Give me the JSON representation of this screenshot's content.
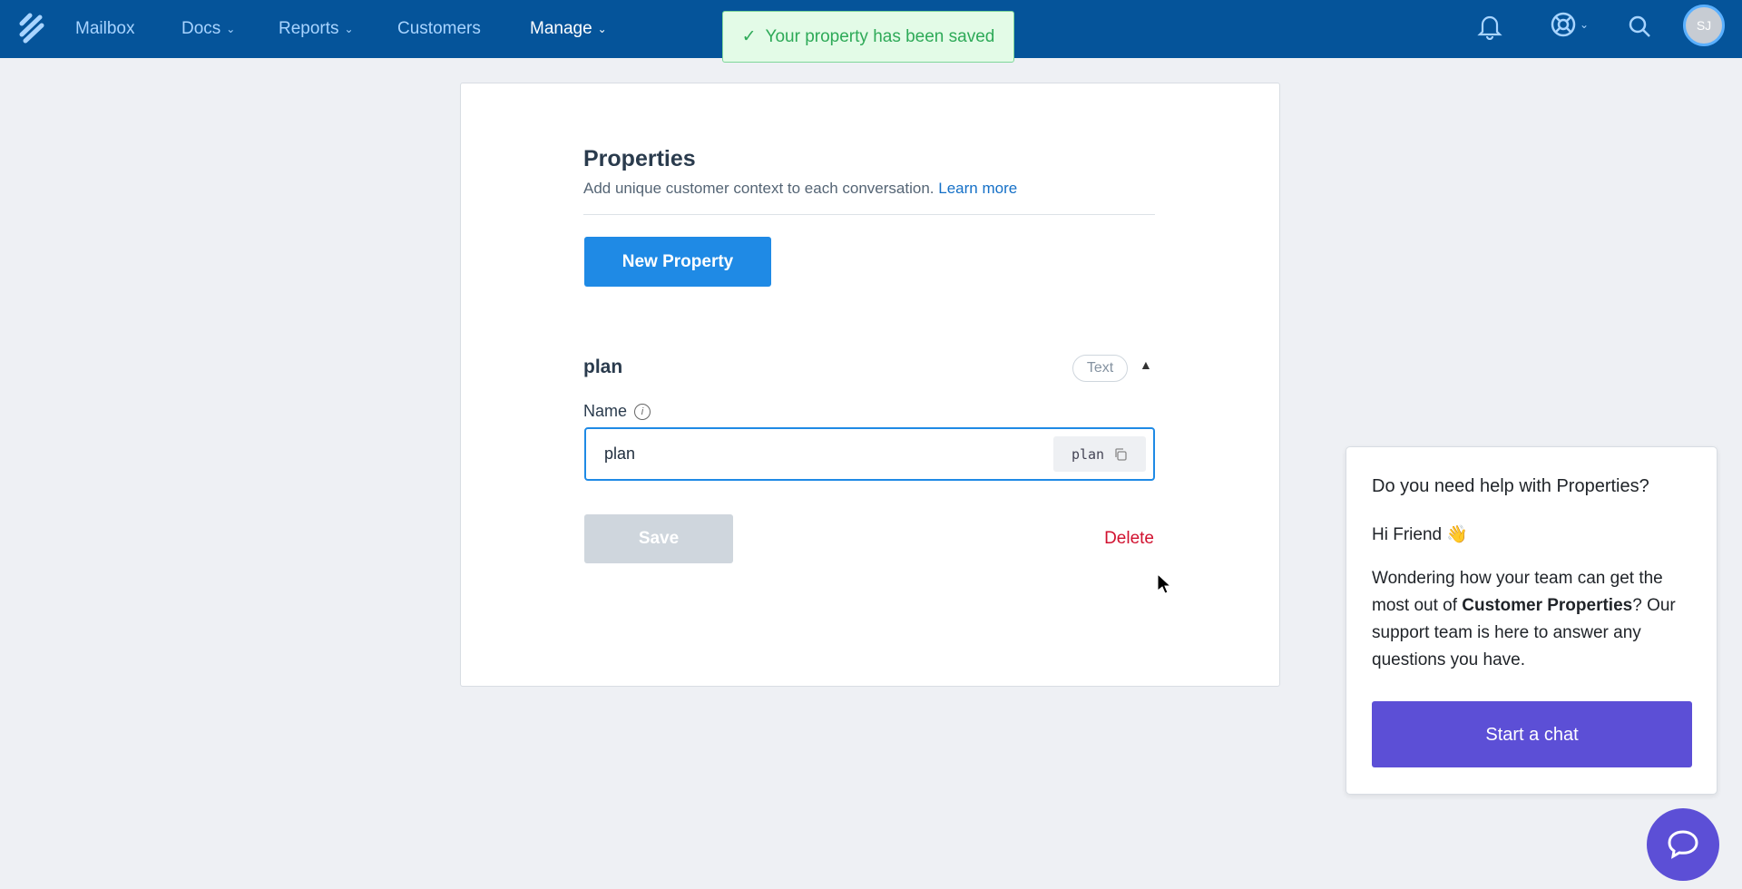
{
  "nav": {
    "items": [
      {
        "label": "Mailbox",
        "dropdown": false
      },
      {
        "label": "Docs",
        "dropdown": true
      },
      {
        "label": "Reports",
        "dropdown": true
      },
      {
        "label": "Customers",
        "dropdown": false
      },
      {
        "label": "Manage",
        "dropdown": true,
        "active": true
      }
    ],
    "avatar_initials": "SJ",
    "icons": [
      "bell-icon",
      "lifebuoy-icon",
      "search-icon"
    ]
  },
  "toast": {
    "message": "Your property has been saved"
  },
  "page": {
    "title": "Properties",
    "subtitle": "Add unique customer context to each conversation.",
    "learn_more": "Learn more",
    "new_button": "New Property"
  },
  "property": {
    "name": "plan",
    "type_badge": "Text",
    "field_label": "Name",
    "field_value": "plan",
    "slug": "plan",
    "save_label": "Save",
    "delete_label": "Delete"
  },
  "help": {
    "title": "Do you need help with Properties?",
    "greeting": "Hi Friend 👋",
    "body_pre": "Wondering how your team can get the most out of ",
    "body_bold": "Customer Properties",
    "body_post": "? Our support team is here to answer any questions you have.",
    "button": "Start a chat"
  },
  "colors": {
    "nav": "#05549a",
    "primary": "#1f8ae5",
    "danger": "#d1112f",
    "chat": "#5c4fd6",
    "toast": "#2eaa58"
  }
}
